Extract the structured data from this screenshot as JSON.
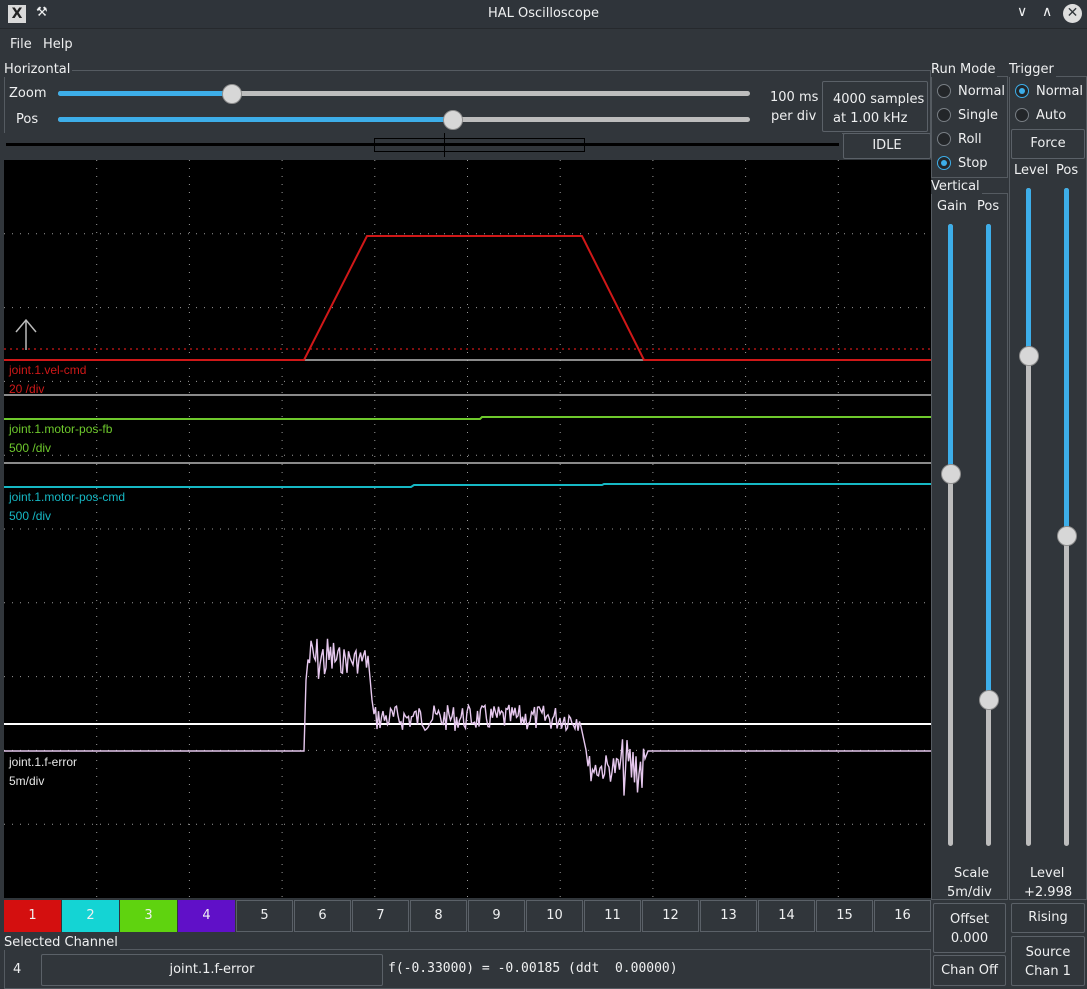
{
  "window": {
    "title": "HAL Oscilloscope",
    "app_icon": "x-icon",
    "pin_icon": "pin-icon"
  },
  "menu": {
    "file": "File",
    "help": "Help"
  },
  "horizontal": {
    "group_label": "Horizontal",
    "zoom_label": "Zoom",
    "zoom_value": 0.33,
    "pos_label": "Pos",
    "pos_value": 0.6,
    "rate_line1": "100 ms",
    "rate_line2": "per div",
    "samples_line1": "4000 samples",
    "samples_line2": "at 1.00 kHz",
    "status": "IDLE"
  },
  "run_mode": {
    "label": "Run Mode",
    "options": [
      "Normal",
      "Single",
      "Roll",
      "Stop"
    ],
    "selected": "Stop"
  },
  "trigger": {
    "label": "Trigger",
    "options": [
      "Normal",
      "Auto"
    ],
    "selected": "Normal",
    "force": "Force",
    "level_label": "Level",
    "pos_label": "Pos",
    "level_value": 0.74,
    "pos_value": 0.45,
    "level_caption": "Level",
    "level_reading": "+2.998",
    "edge_button": "Rising",
    "source_line1": "Source",
    "source_line2": "Chan  1"
  },
  "vertical": {
    "label": "Vertical",
    "gain_label": "Gain",
    "pos_label": "Pos",
    "gain_value": 0.6,
    "pos_value": 0.24,
    "scale_label": "Scale",
    "scale_value": "5m/div",
    "offset_label": "Offset",
    "offset_value": "0.000",
    "chan_off": "Chan Off"
  },
  "traces": [
    {
      "name": "joint.1.vel-cmd",
      "scale": "20 /div",
      "color": "#d01818"
    },
    {
      "name": "joint.1.motor-pos-fb",
      "scale": "500 /div",
      "color": "#6ec92c"
    },
    {
      "name": "joint.1.motor-pos-cmd",
      "scale": "500 /div",
      "color": "#16b8c4"
    },
    {
      "name": "joint.1.f-error",
      "scale": "5m/div",
      "color": "#e6c8ee"
    }
  ],
  "channels": [
    {
      "label": "1",
      "color": "#d40f0f"
    },
    {
      "label": "2",
      "color": "#14d4d4"
    },
    {
      "label": "3",
      "color": "#5fd30f"
    },
    {
      "label": "4",
      "color": "#6010c8"
    },
    {
      "label": "5"
    },
    {
      "label": "6"
    },
    {
      "label": "7"
    },
    {
      "label": "8"
    },
    {
      "label": "9"
    },
    {
      "label": "10"
    },
    {
      "label": "11"
    },
    {
      "label": "12"
    },
    {
      "label": "13"
    },
    {
      "label": "14"
    },
    {
      "label": "15"
    },
    {
      "label": "16"
    }
  ],
  "selected_channel": {
    "label": "Selected Channel",
    "number": "4",
    "name": "joint.1.f-error",
    "readout": "f(-0.33000) = -0.00185 (ddt  0.00000)"
  }
}
